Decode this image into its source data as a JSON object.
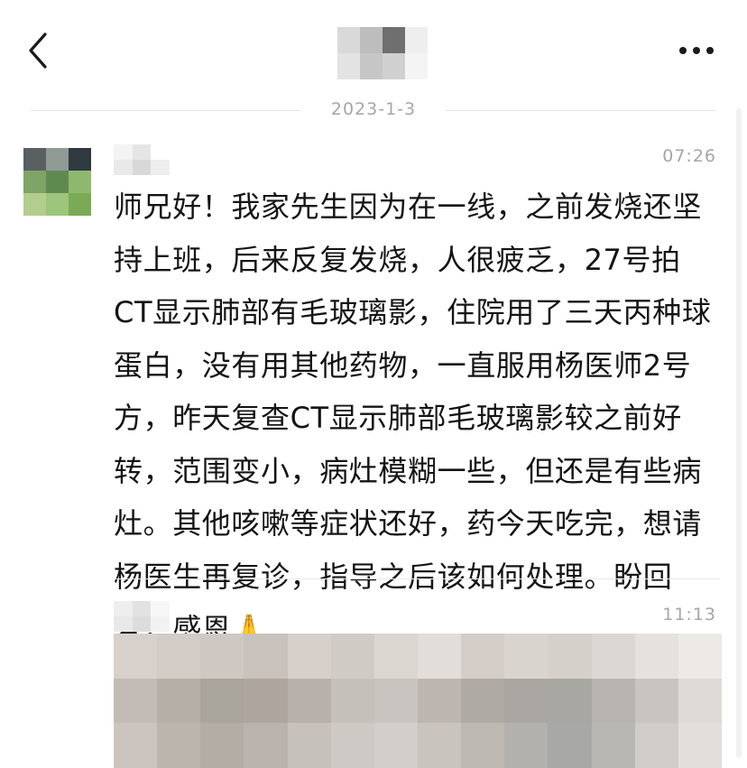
{
  "nav": {
    "back_icon": "chevron-left-icon",
    "more_icon": "more-horizontal-icon"
  },
  "divider": {
    "date": "2023-1-3"
  },
  "messages": [
    {
      "time": "07:26",
      "text": "师兄好！我家先生因为在一线，之前发烧还坚\n持上班，后来反复发烧，人很疲乏，27号拍\nCT显示肺部有毛玻璃影，住院用了三天丙种球\n蛋白，没有用其他药物，一直服用杨医师2号\n方，昨天复查CT显示肺部毛玻璃影较之前好\n转，范围变小，病灶模糊一些，但还是有些病\n灶。其他咳嗽等症状还好，药今天吃完，想请\n杨医生再复诊，指导之后该如何处理。盼回\n复，感恩🙏"
    },
    {
      "time": "11:13"
    }
  ],
  "colors": {
    "time_text": "#a6a6a6",
    "body_text": "#141414",
    "divider_line": "#e6e6e6"
  }
}
